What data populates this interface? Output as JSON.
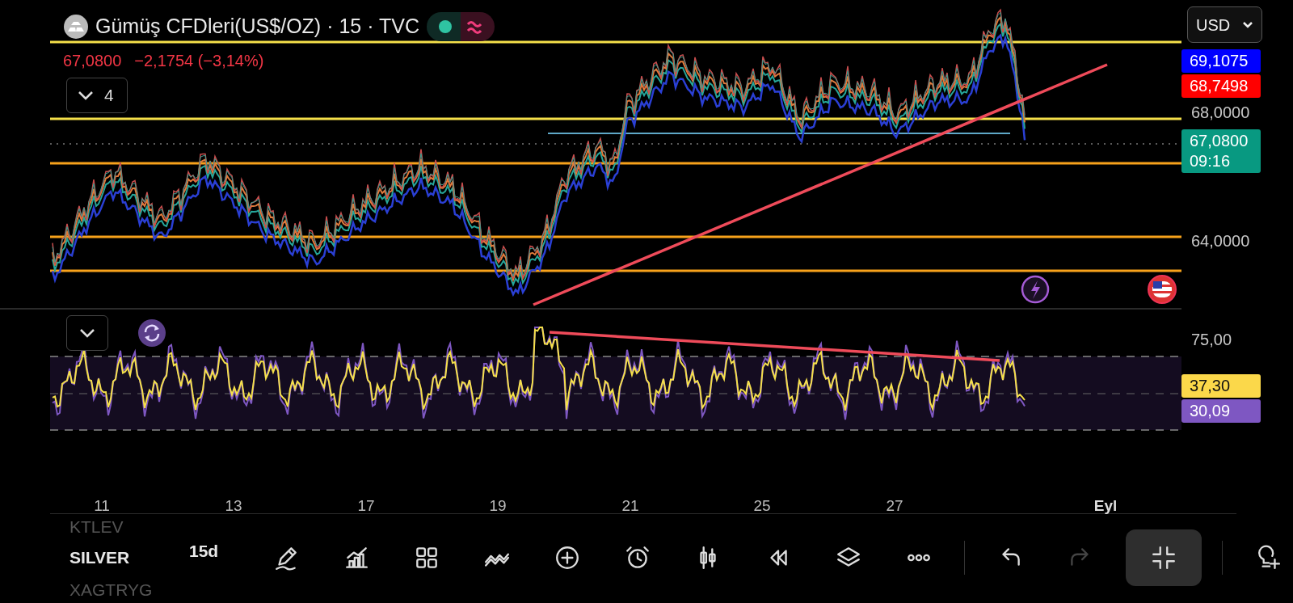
{
  "header": {
    "symbol": "Gümüş CFDleri(US$/OZ) · 15 · TVC",
    "market_open": true,
    "price": "67,0800",
    "change": "−2,1754 (−3,14%)",
    "indicators_count": "4"
  },
  "currency": "USD",
  "price_axis": [
    {
      "text": "69,1075",
      "kind": "tag",
      "color": "#0000ff"
    },
    {
      "text": "68,7498",
      "kind": "tag",
      "color": "#ff0000"
    },
    {
      "text": "68,0000",
      "kind": "tick"
    },
    {
      "text": "67,0800",
      "sub": "09:16",
      "kind": "tag",
      "color": "#089981"
    },
    {
      "text": "64,0000",
      "kind": "tick"
    }
  ],
  "rsi_axis": [
    {
      "text": "75,00",
      "kind": "tick"
    },
    {
      "text": "37,30",
      "kind": "tag",
      "color": "#fbd84a"
    },
    {
      "text": "30,09",
      "kind": "tag",
      "color": "#7e57c2"
    }
  ],
  "time_axis": [
    {
      "text": "11",
      "kind": "day"
    },
    {
      "text": "13",
      "kind": "day"
    },
    {
      "text": "17",
      "kind": "day"
    },
    {
      "text": "19",
      "kind": "day"
    },
    {
      "text": "21",
      "kind": "day"
    },
    {
      "text": "25",
      "kind": "day"
    },
    {
      "text": "27",
      "kind": "day"
    },
    {
      "text": "Eyl",
      "kind": "month"
    }
  ],
  "picker": {
    "symbols": [
      {
        "text": "KTLEV",
        "selected": false
      },
      {
        "text": "SILVER",
        "selected": true
      },
      {
        "text": "XAGTRYG",
        "selected": false
      }
    ],
    "interval": "15d"
  },
  "toolbar": {
    "redo_disabled": true,
    "fullscreen_active": true
  }
}
